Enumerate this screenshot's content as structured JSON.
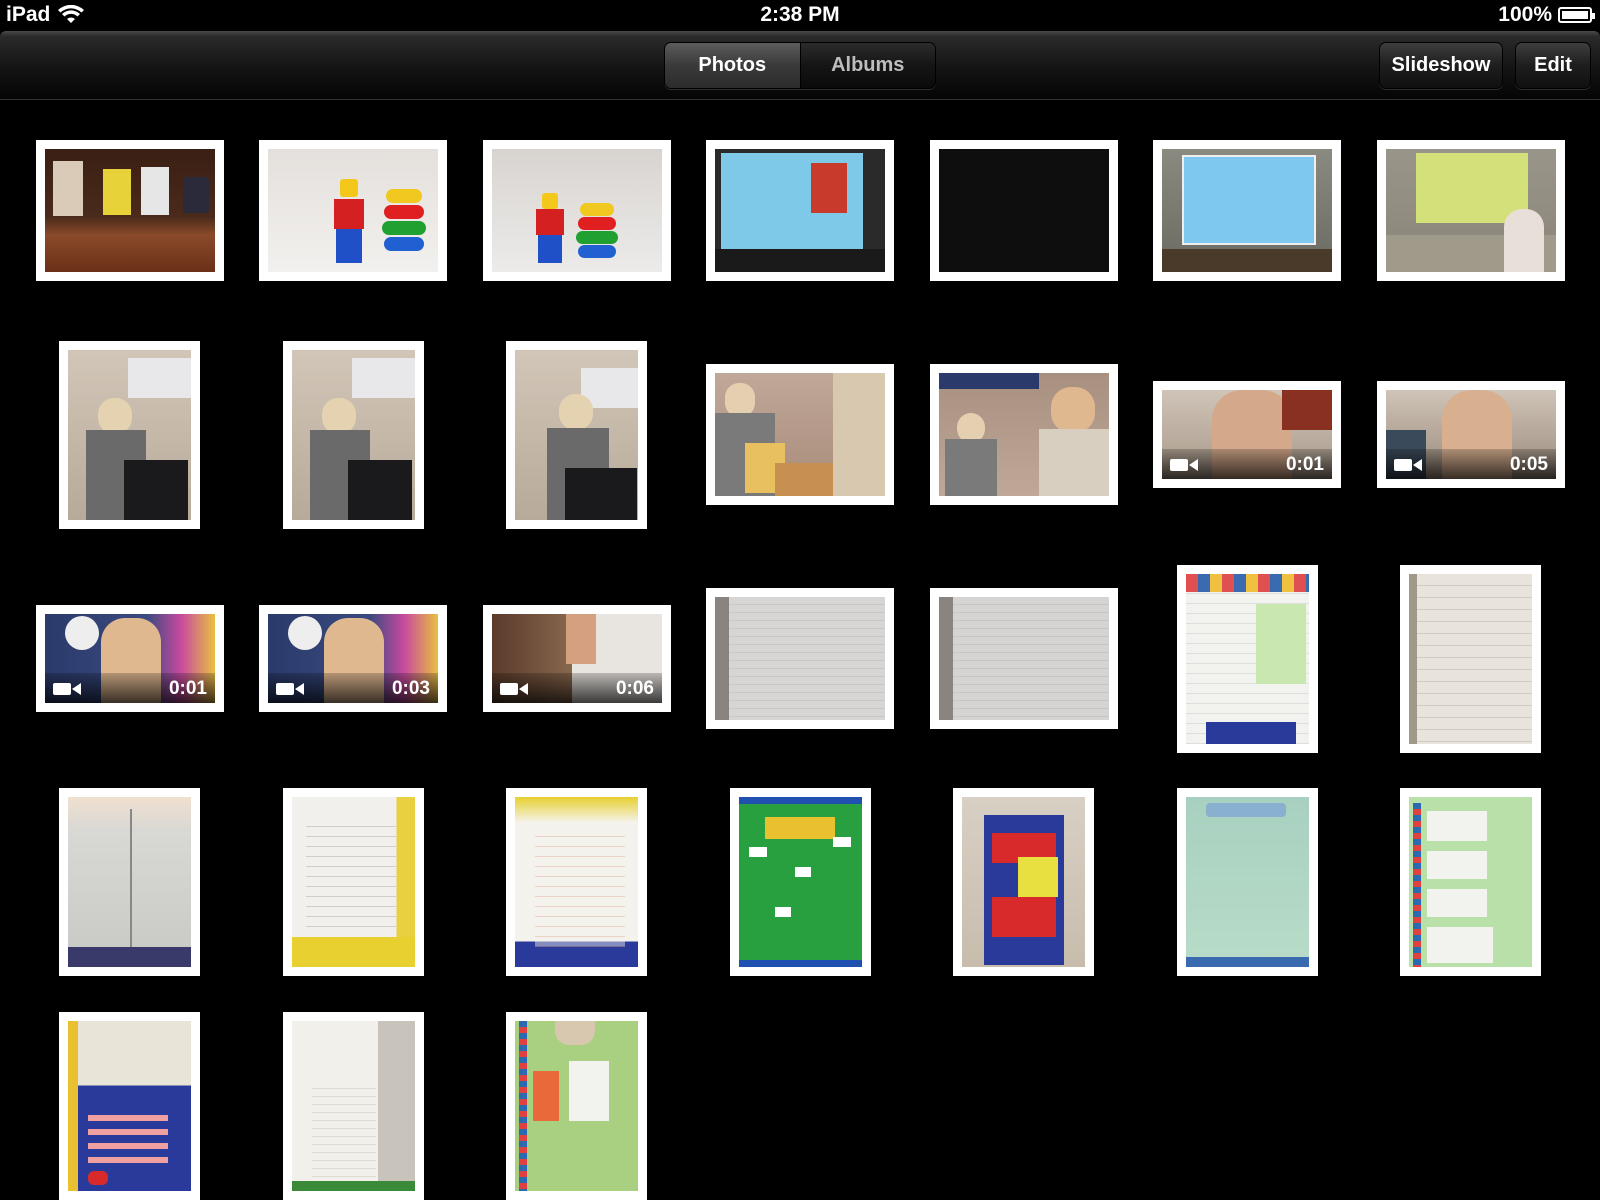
{
  "status_bar": {
    "device": "iPad",
    "time": "2:38 PM",
    "battery": "100%"
  },
  "nav": {
    "tabs": [
      {
        "label": "Photos",
        "selected": true
      },
      {
        "label": "Albums",
        "selected": false
      }
    ],
    "slideshow_label": "Slideshow",
    "edit_label": "Edit"
  },
  "colors": {
    "background": "#000000",
    "thumb_frame": "#ffffff"
  },
  "videos": {
    "v1": "0:01",
    "v2": "0:05",
    "v3": "0:01",
    "v4": "0:03",
    "v5": "0:06"
  }
}
